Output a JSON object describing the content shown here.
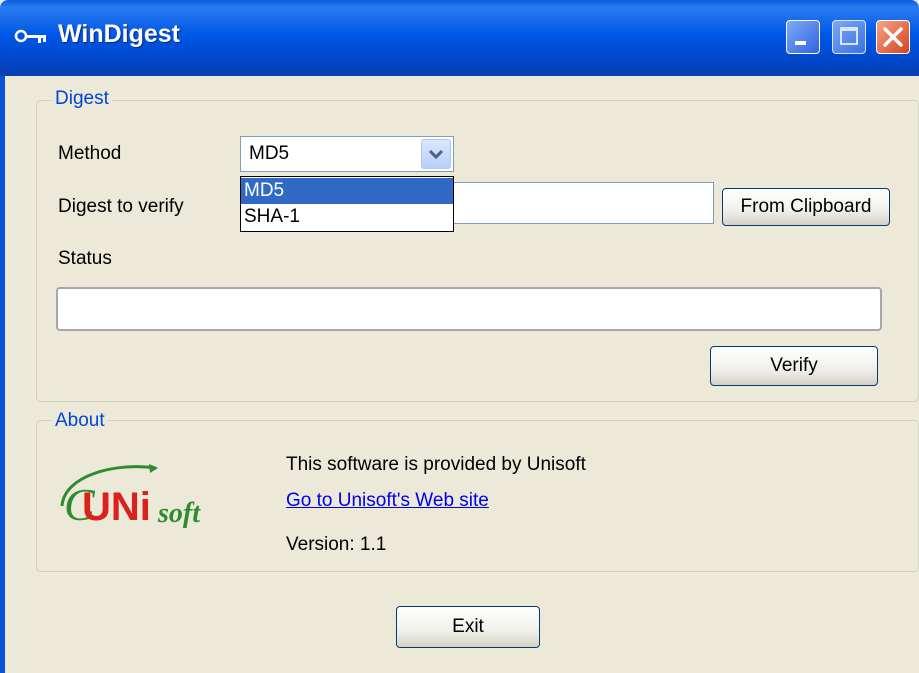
{
  "window": {
    "title": "WinDigest"
  },
  "digest": {
    "legend": "Digest",
    "method_label": "Method",
    "method_selected": "MD5",
    "method_options": [
      "MD5",
      "SHA-1"
    ],
    "digest_label": "Digest to verify",
    "digest_value": "",
    "from_clipboard": "From Clipboard",
    "status_label": "Status",
    "status_value": "",
    "verify": "Verify"
  },
  "about": {
    "legend": "About",
    "logo_text": "UNIsoft",
    "provided_by": "This software is provided by Unisoft",
    "website_link": "Go to Unisoft's Web site",
    "version": "Version: 1.1"
  },
  "exit": "Exit",
  "colors": {
    "titlebar": "#0058e6",
    "legend": "#0046d5",
    "selection": "#316ac5",
    "logo_red": "#d9211e",
    "logo_green": "#2e8b2e"
  },
  "icons": [
    "key-icon",
    "minimize-icon",
    "maximize-icon",
    "close-icon",
    "chevron-down-icon"
  ]
}
